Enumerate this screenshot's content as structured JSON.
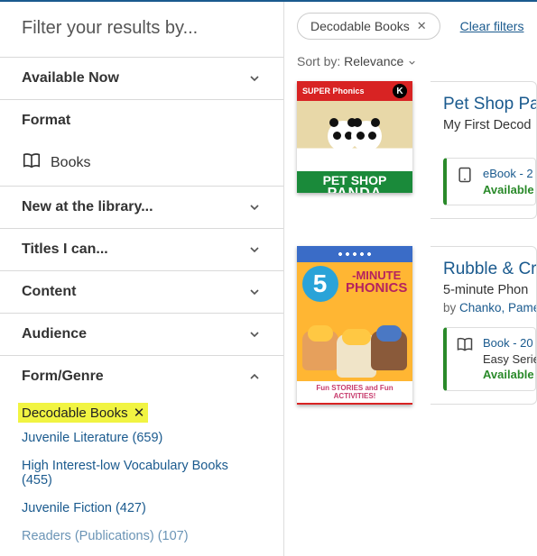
{
  "filter_heading": "Filter your results by...",
  "chip": {
    "label": "Decodable Books"
  },
  "clear_filters": "Clear filters",
  "sort": {
    "label": "Sort by:",
    "value": "Relevance"
  },
  "filters": {
    "available_now": "Available Now",
    "format": "Format",
    "format_books": "Books",
    "new_at_library": "New at the library...",
    "titles_i_can": "Titles I can...",
    "content": "Content",
    "audience": "Audience",
    "form_genre": "Form/Genre"
  },
  "form_genre_values": {
    "selected": "Decodable Books",
    "others": [
      "Juvenile Literature (659)",
      "High Interest-low Vocabulary Books (455)",
      "Juvenile Fiction (427)",
      "Readers (Publications) (107)"
    ]
  },
  "cover1": {
    "super": "SUPER",
    "phonics": "Phonics",
    "grade": "K",
    "line1": "PET SHOP",
    "line2": "PANDA"
  },
  "cover2": {
    "five": "5",
    "minute": "-MINUTE",
    "phonics": "PHONICS",
    "tag": "Fun STORIES and Fun ACTIVITIES!"
  },
  "results": [
    {
      "title": "Pet Shop Pa",
      "subtitle": "My First Decod",
      "format_line": "eBook - 2",
      "availability": "Available"
    },
    {
      "title": "Rubble & Cr",
      "subtitle": "5-minute Phon",
      "byline_prefix": "by ",
      "byline_link": "Chanko, Pame",
      "format_line": "Book - 20",
      "format_line2": "Easy Serie",
      "availability": "Available"
    }
  ]
}
